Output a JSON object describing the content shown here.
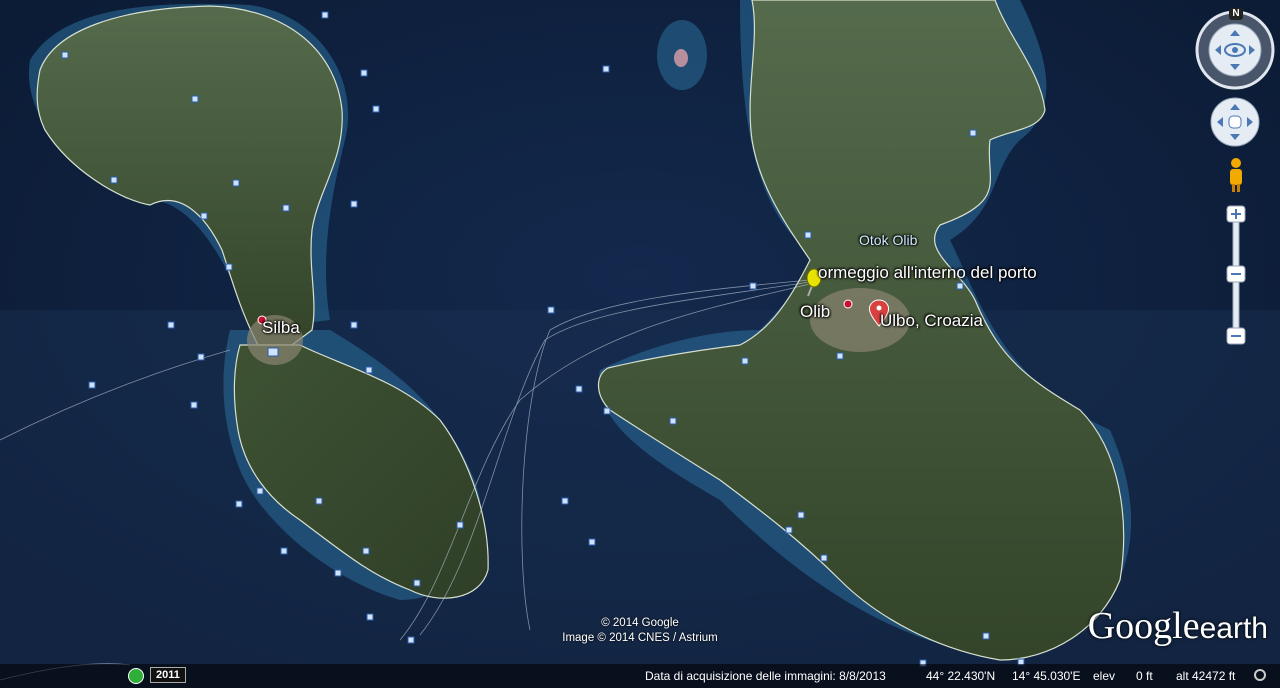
{
  "placemarks": {
    "mooring": "ormeggio all'interno del porto",
    "olib_village": "Olib",
    "silba": "Silba",
    "search_result": "Ulbo, Croazia",
    "island": "Otok Olib"
  },
  "credits": {
    "line1": "© 2014 Google",
    "line2": "Image © 2014 CNES / Astrium"
  },
  "logo": {
    "google": "Google",
    "earth": "earth"
  },
  "compass": {
    "north": "N"
  },
  "timeline": {
    "year": "2011"
  },
  "status": {
    "imagery_date": "Data di acquisizione delle immagini: 8/8/2013",
    "lat": "44° 22.430'N",
    "lon": "14° 45.030'E",
    "elev_label": "elev",
    "elev_value": "0 ft",
    "alt": "alt  42472 ft"
  },
  "colors": {
    "sea": "#0f2140",
    "land": "#3b4b32",
    "shallow": "#2d6f9a",
    "pin": "#e8e200",
    "balloon": "#d9413f"
  }
}
